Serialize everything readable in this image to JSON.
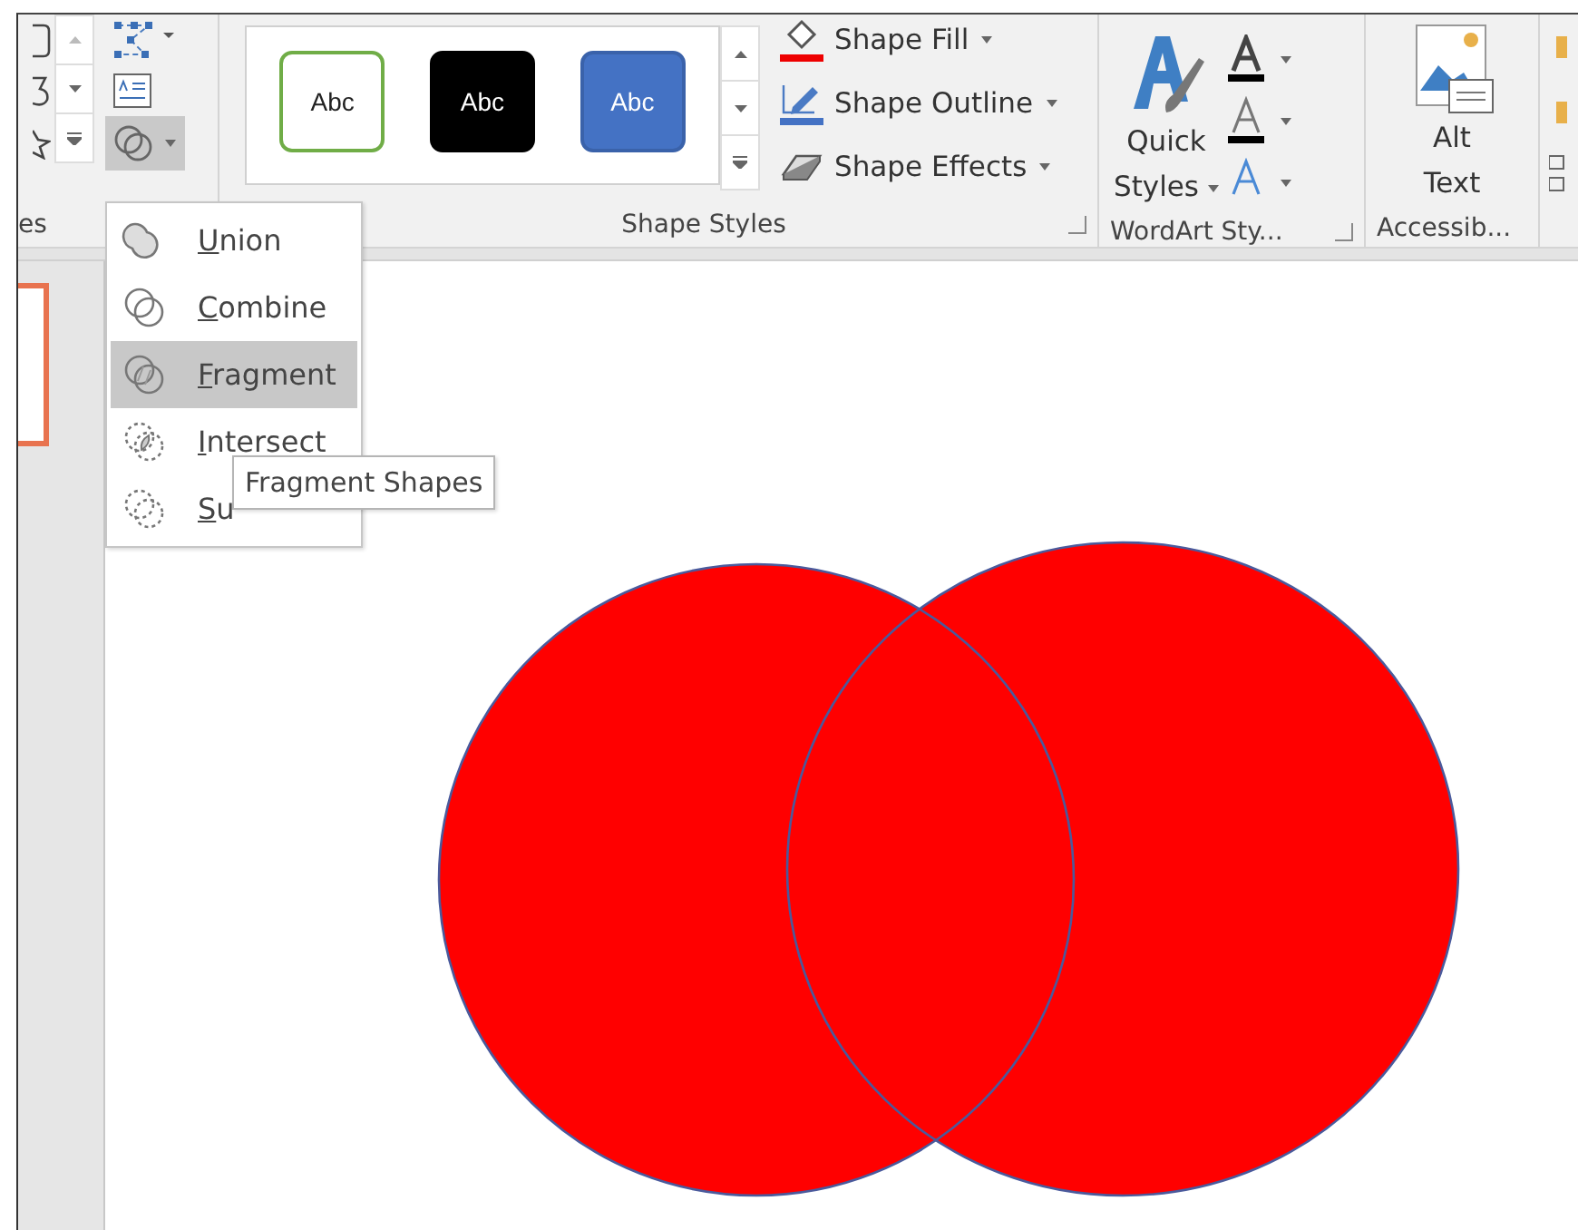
{
  "ribbon": {
    "cut_group_label": "es",
    "merge_shapes_button": {
      "pressed": true
    },
    "shape_styles": {
      "label": "Shape Styles",
      "swatches": [
        {
          "text": "Abc",
          "kind": "outline"
        },
        {
          "text": "Abc",
          "kind": "dark"
        },
        {
          "text": "Abc",
          "kind": "blue"
        }
      ],
      "commands": [
        {
          "label": "Shape Fill",
          "kind": "fill"
        },
        {
          "label": "Shape Outline",
          "kind": "outline"
        },
        {
          "label": "Shape Effects",
          "kind": "effects"
        }
      ]
    },
    "wordart": {
      "label": "WordArt Sty...",
      "quick_styles": [
        "Quick",
        "Styles"
      ]
    },
    "accessibility": {
      "label": "Accessib...",
      "alt_text": [
        "Alt",
        "Text"
      ]
    }
  },
  "merge_menu": {
    "items": [
      {
        "label": "Union",
        "kind": "union",
        "selected": false
      },
      {
        "label": "Combine",
        "kind": "combine",
        "selected": false
      },
      {
        "label": "Fragment",
        "kind": "fragment",
        "selected": true
      },
      {
        "label": "Intersect",
        "kind": "intersect",
        "selected": false
      },
      {
        "label": "Su",
        "kind": "subtract",
        "selected": false
      }
    ]
  },
  "tooltip": "Fragment Shapes",
  "slide": {
    "shapes": [
      {
        "kind": "circle"
      },
      {
        "kind": "circle"
      }
    ]
  }
}
